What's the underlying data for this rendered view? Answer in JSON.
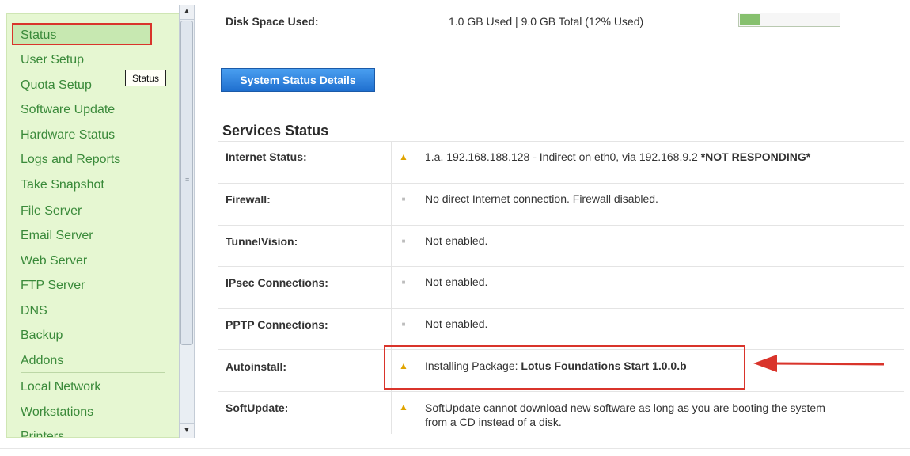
{
  "sidebar": {
    "items": [
      {
        "label": "Status"
      },
      {
        "label": "User Setup"
      },
      {
        "label": "Quota Setup"
      },
      {
        "label": "Software Update"
      },
      {
        "label": "Hardware Status"
      },
      {
        "label": "Logs and Reports"
      },
      {
        "label": "Take Snapshot"
      },
      {
        "label": "File Server"
      },
      {
        "label": "Email Server"
      },
      {
        "label": "Web Server"
      },
      {
        "label": "FTP Server"
      },
      {
        "label": "DNS"
      },
      {
        "label": "Backup"
      },
      {
        "label": "Addons"
      },
      {
        "label": "Local Network"
      },
      {
        "label": "Workstations"
      },
      {
        "label": "Printers"
      }
    ],
    "tooltip": "Status"
  },
  "disk": {
    "label": "Disk Space Used:",
    "value": "1.0 GB Used | 9.0 GB Total (12% Used)",
    "percent": 12
  },
  "system_status_button": "System Status Details",
  "services": {
    "title": "Services Status",
    "rows": [
      {
        "label": "Internet Status:",
        "icon": "warning-icon",
        "value_plain": "1.a. 192.168.188.128 - Indirect on eth0, via 192.168.9.2",
        "value_bold": "*NOT RESPONDING*"
      },
      {
        "label": "Firewall:",
        "icon": "bullet-icon",
        "value_plain": "No direct Internet connection. Firewall disabled."
      },
      {
        "label": "TunnelVision:",
        "icon": "bullet-icon",
        "value_plain": "Not enabled."
      },
      {
        "label": "IPsec Connections:",
        "icon": "bullet-icon",
        "value_plain": "Not enabled."
      },
      {
        "label": "PPTP Connections:",
        "icon": "bullet-icon",
        "value_plain": "Not enabled."
      },
      {
        "label": "Autoinstall:",
        "icon": "warning-icon",
        "value_plain": "Installing Package:",
        "value_bold": "Lotus Foundations Start 1.0.0.b"
      },
      {
        "label": "SoftUpdate:",
        "icon": "warning-icon",
        "value_line1": "SoftUpdate cannot download new software as long as you are booting the system",
        "value_line2": "from a CD instead of a disk."
      }
    ]
  },
  "colors": {
    "sidebar_bg": "#e6f7d2",
    "link": "#3a8a3a",
    "highlight": "#d9342b",
    "button": "#2f86e0",
    "warning": "#e0a400"
  }
}
